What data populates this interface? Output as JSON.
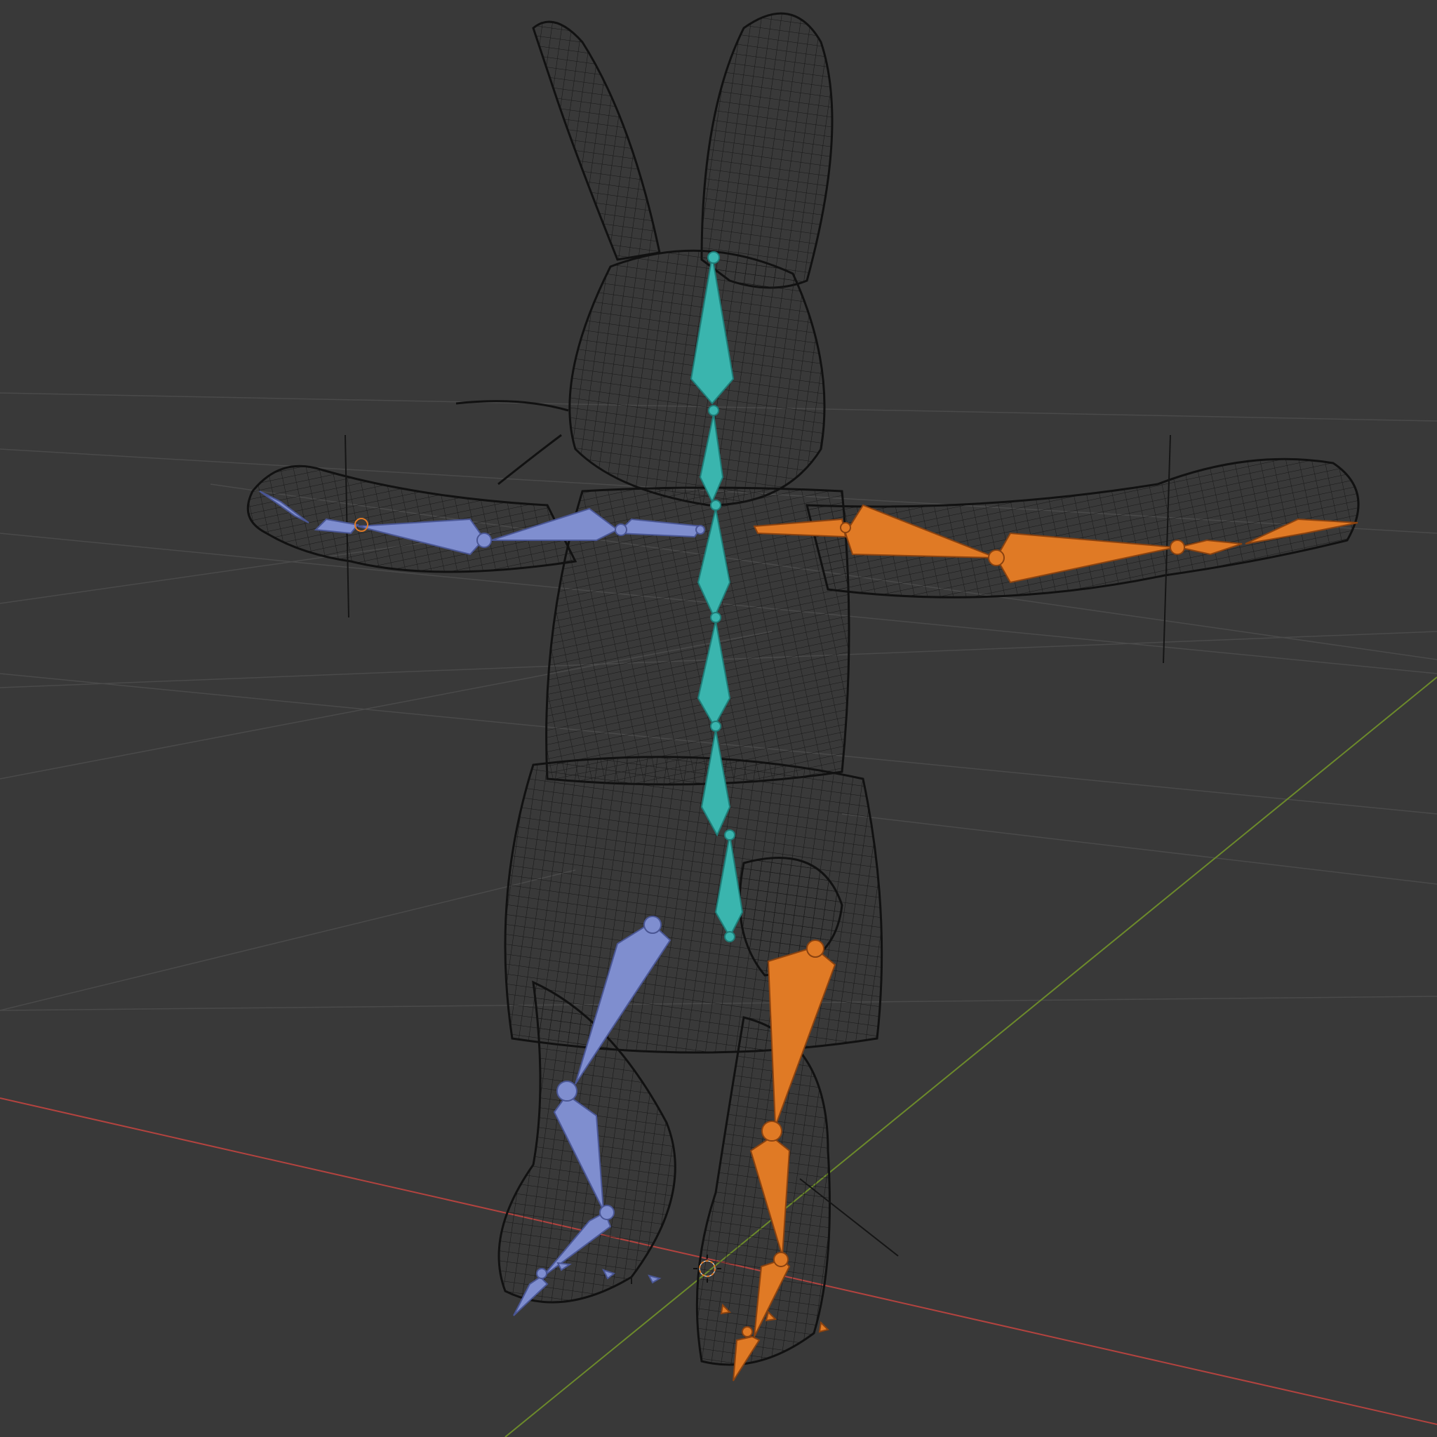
{
  "viewport": {
    "mode": "3d-viewport-wireframe",
    "background": "#393939",
    "grid_color": "#4a4a4a",
    "axis_x_color": "#b3433f",
    "axis_y_color": "#6c8a2b"
  },
  "mesh": {
    "name": "rabbit-wireframe-mesh",
    "wire_color": "#141414",
    "fill_color": "#2f2f2f"
  },
  "armature": {
    "spine_color": "#3ab5ae",
    "left_side_color": "#7f8ecf",
    "right_side_color": "#e07a25",
    "bone_groups": [
      "spine",
      "left-arm",
      "right-arm",
      "left-leg",
      "right-leg"
    ]
  },
  "icons": [
    "3d-cursor-icon",
    "empty-axes-icon"
  ]
}
